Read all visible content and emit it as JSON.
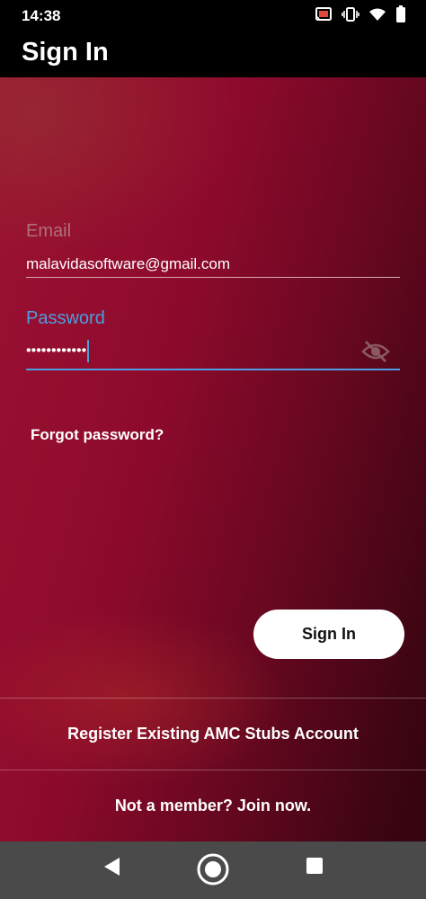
{
  "status_bar": {
    "time": "14:38",
    "icons": [
      "cast-icon",
      "vibrate-icon",
      "wifi-icon",
      "battery-icon"
    ]
  },
  "app_bar": {
    "title": "Sign In"
  },
  "form": {
    "email_label": "Email",
    "email_value": "malavidasoftware@gmail.com",
    "password_label": "Password",
    "password_value": "••••••••••••",
    "password_visibility_icon": "eye-off-icon",
    "forgot_password": "Forgot password?",
    "sign_in_button": "Sign In"
  },
  "links": {
    "register": "Register Existing AMC Stubs Account",
    "join": "Not a member? Join now."
  },
  "nav_bar": {
    "icons": [
      "back-icon",
      "home-icon",
      "recents-icon"
    ]
  },
  "colors": {
    "accent_blue": "#4d9de0",
    "background_red": "#8e0a2c",
    "dark_red": "#3f0513"
  }
}
